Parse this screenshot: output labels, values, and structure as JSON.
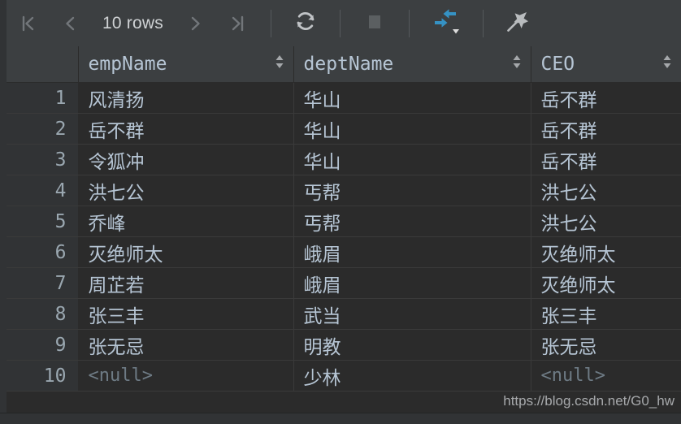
{
  "toolbar": {
    "first_page_icon": "first-page-icon",
    "prev_page_icon": "previous-page-icon",
    "rows_label": "10 rows",
    "next_page_icon": "next-page-icon",
    "last_page_icon": "last-page-icon",
    "refresh_icon": "refresh-icon",
    "stop_icon": "stop-icon",
    "transpose_icon": "transpose-arrows-icon",
    "transpose_dropdown_icon": "chevron-down-icon",
    "pin_icon": "pin-icon",
    "accent_color": "#3592c4",
    "background_color": "#3c3f41"
  },
  "table": {
    "row_number_header": "",
    "columns": [
      {
        "label": "empName",
        "sort_icon": "sort-arrows-icon"
      },
      {
        "label": "deptName",
        "sort_icon": "sort-arrows-icon"
      },
      {
        "label": "CEO",
        "sort_icon": "sort-arrows-icon"
      }
    ],
    "rows": [
      {
        "n": "1",
        "empName": "风清扬",
        "deptName": "华山",
        "ceo": "岳不群"
      },
      {
        "n": "2",
        "empName": "岳不群",
        "deptName": "华山",
        "ceo": "岳不群"
      },
      {
        "n": "3",
        "empName": "令狐冲",
        "deptName": "华山",
        "ceo": "岳不群"
      },
      {
        "n": "4",
        "empName": "洪七公",
        "deptName": "丐帮",
        "ceo": "洪七公"
      },
      {
        "n": "5",
        "empName": "乔峰",
        "deptName": "丐帮",
        "ceo": "洪七公"
      },
      {
        "n": "6",
        "empName": "灭绝师太",
        "deptName": "峨眉",
        "ceo": "灭绝师太"
      },
      {
        "n": "7",
        "empName": "周芷若",
        "deptName": "峨眉",
        "ceo": "灭绝师太"
      },
      {
        "n": "8",
        "empName": "张三丰",
        "deptName": "武当",
        "ceo": "张三丰"
      },
      {
        "n": "9",
        "empName": "张无忌",
        "deptName": "明教",
        "ceo": "张无忌"
      },
      {
        "n": "10",
        "empName": "<null>",
        "deptName": "少林",
        "ceo": "<null>"
      }
    ],
    "text_color": "#b6c5d4",
    "null_color": "#6e7b85"
  },
  "watermark": {
    "text": "https://blog.csdn.net/G0_hw"
  }
}
